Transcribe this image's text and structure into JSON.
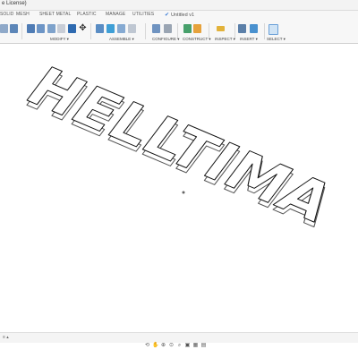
{
  "window": {
    "title": "e License)"
  },
  "document": {
    "name": "Untitled v1",
    "saved_icon": "check-icon"
  },
  "tabs": [
    "SOLID",
    "MESH",
    "SHEET METAL",
    "PLASTIC",
    "MANAGE",
    "UTILITIES"
  ],
  "toolbar_groups": [
    "MODIFY ▾",
    "ASSEMBLE ▾",
    "CONFIGURE ▾",
    "CONSTRUCT ▾",
    "INSPECT ▾",
    "INSERT ▾",
    "SELECT ▾"
  ],
  "canvas": {
    "model_text": "HELLTIMA"
  },
  "status": {
    "left": "≡ ▴"
  },
  "nav_icons": [
    "orbit-icon",
    "pan-icon",
    "zoom-icon",
    "fit-icon",
    "zoom-window-icon",
    "display-settings-icon",
    "grid-icon",
    "viewport-icon"
  ],
  "colors": {
    "accent": "#3a7bd5",
    "toolbar_bg": "#f7f7f7"
  }
}
